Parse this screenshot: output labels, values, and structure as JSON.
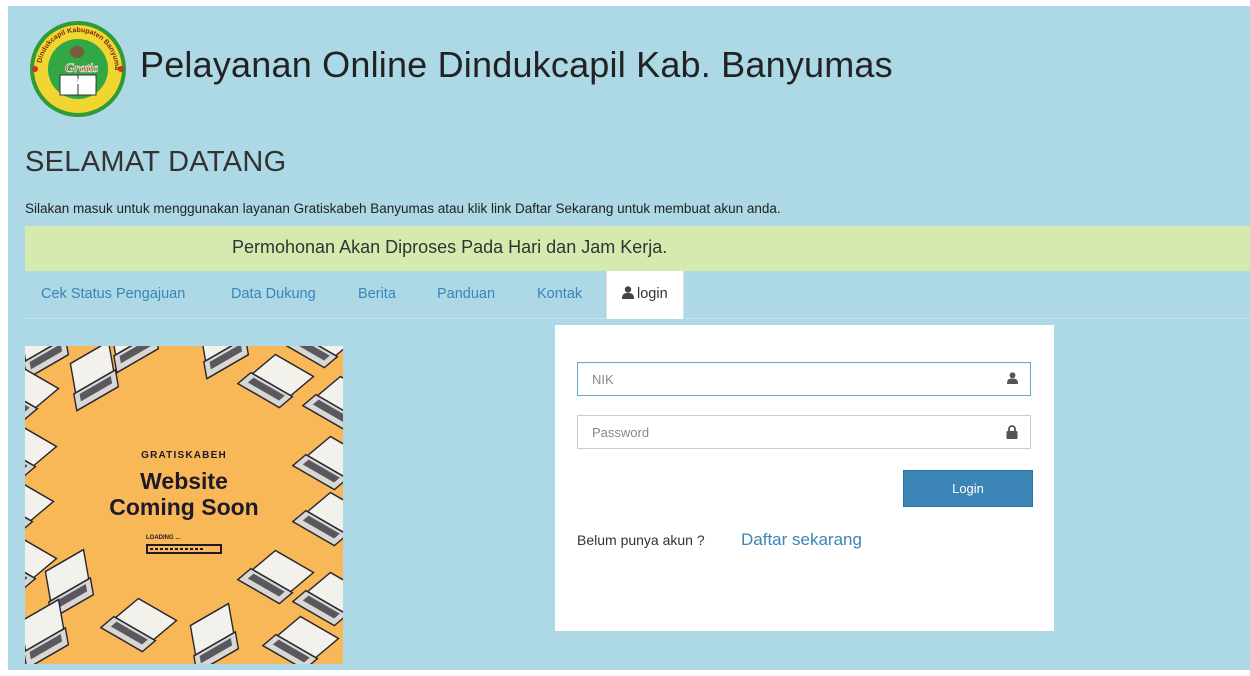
{
  "header": {
    "logo_text": "Dindukcapil Kabupaten Banyumas Gratis Kabeh",
    "site_title": "Pelayanan Online Dindukcapil Kab. Banyumas"
  },
  "welcome": {
    "heading": "SELAMAT DATANG",
    "intro": "Silakan masuk untuk menggunakan layanan Gratiskabeh Banyumas atau klik link Daftar Sekarang untuk membuat akun anda."
  },
  "notice": {
    "text": "Permohonan Akan Diproses Pada Hari dan Jam Kerja.",
    "color": "#d6eab0"
  },
  "nav": {
    "items": [
      {
        "label": "Cek Status Pengajuan"
      },
      {
        "label": "Data Dukung"
      },
      {
        "label": "Berita"
      },
      {
        "label": "Panduan"
      },
      {
        "label": "Kontak"
      },
      {
        "label": "login",
        "icon": "user-icon",
        "active": true
      }
    ]
  },
  "poster": {
    "brand": "GRATISKABEH",
    "headline_line1": "Website",
    "headline_line2": "Coming Soon",
    "loading_label": "LOADING ...",
    "background_color": "#f9b858",
    "icon": "laptop-icon"
  },
  "login": {
    "nik_placeholder": "NIK",
    "password_placeholder": "Password",
    "nik_icon": "user-icon",
    "password_icon": "lock-icon",
    "submit_label": "Login",
    "signup_question": "Belum punya akun ?",
    "signup_link": "Daftar sekarang"
  },
  "colors": {
    "page_background": "#add8e6",
    "link": "#3a85b6",
    "button": "#3c86b7"
  }
}
